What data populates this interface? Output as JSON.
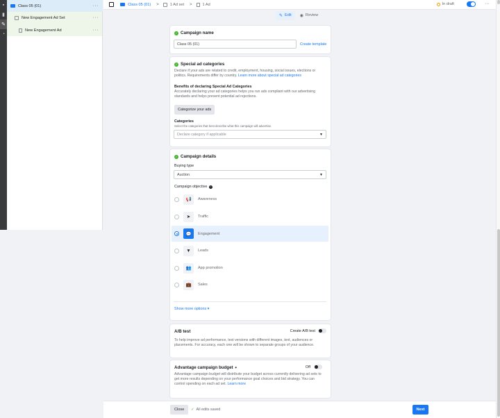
{
  "tree": {
    "items": [
      {
        "label": "Class 05 (01)",
        "icon": "folder-icon"
      },
      {
        "label": "New Engagement Ad Set",
        "icon": "grid-icon"
      },
      {
        "label": "New Engagement Ad",
        "icon": "doc-icon"
      }
    ],
    "more": "···"
  },
  "topbar": {
    "crumbs": [
      {
        "label": "Class 05 (01)",
        "icon": "folder-icon"
      },
      {
        "label": "1 Ad set",
        "icon": "grid-icon"
      },
      {
        "label": "1 Ad",
        "icon": "doc-icon"
      }
    ],
    "separator": ">",
    "status": "In draft",
    "more": "···"
  },
  "mode": {
    "edit": "Edit",
    "review": "Review"
  },
  "campaign_name": {
    "title": "Campaign name",
    "value": "Class 05 (01)",
    "create_template": "Create template"
  },
  "special_ad": {
    "title": "Special ad categories",
    "desc": "Declare if your ads are related to credit, employment, housing, social issues, elections or politics. Requirements differ by country.",
    "learn_more": "Learn more about special ad categories",
    "benefits_title": "Benefits of declaring Special Ad Categories",
    "benefits_desc": "Accurately declaring your ad categories helps you run ads compliant with our advertising standards and helps prevent potential ad rejections.",
    "categorize_button": "Categorize your ads",
    "categories_label": "Categories",
    "categories_hint": "Select the categories that best describe what this campaign will advertise.",
    "categories_placeholder": "Declare category if applicable"
  },
  "campaign_details": {
    "title": "Campaign details",
    "buying_type_label": "Buying type",
    "buying_type_value": "Auction",
    "objective_label": "Campaign objective",
    "objectives": [
      {
        "label": "Awareness",
        "icon": "megaphone-icon",
        "glyph": "📢",
        "selected": false
      },
      {
        "label": "Traffic",
        "icon": "cursor-icon",
        "glyph": "➤",
        "selected": false
      },
      {
        "label": "Engagement",
        "icon": "chat-icon",
        "glyph": "💬",
        "selected": true
      },
      {
        "label": "Leads",
        "icon": "funnel-icon",
        "glyph": "▼",
        "selected": false
      },
      {
        "label": "App promotion",
        "icon": "people-icon",
        "glyph": "👥",
        "selected": false
      },
      {
        "label": "Sales",
        "icon": "briefcase-icon",
        "glyph": "💼",
        "selected": false
      }
    ],
    "show_more": "Show more options ▾"
  },
  "ab_test": {
    "title": "A/B test",
    "toggle_label": "Create A/B test",
    "desc": "To help improve ad performance, test versions with different images, text, audiences or placements. For accuracy, each one will be shown to separate groups of your audience."
  },
  "budget": {
    "title": "Advantage campaign budget",
    "toggle_label": "Off",
    "desc": "Advantage campaign budget will distribute your budget across currently delivering ad sets to get more results depending on your performance goal choices and bid strategy. You can control spending on each ad set.",
    "learn_more": "Learn more"
  },
  "footer": {
    "close": "Close",
    "saved": "All edits saved",
    "next": "Next"
  }
}
